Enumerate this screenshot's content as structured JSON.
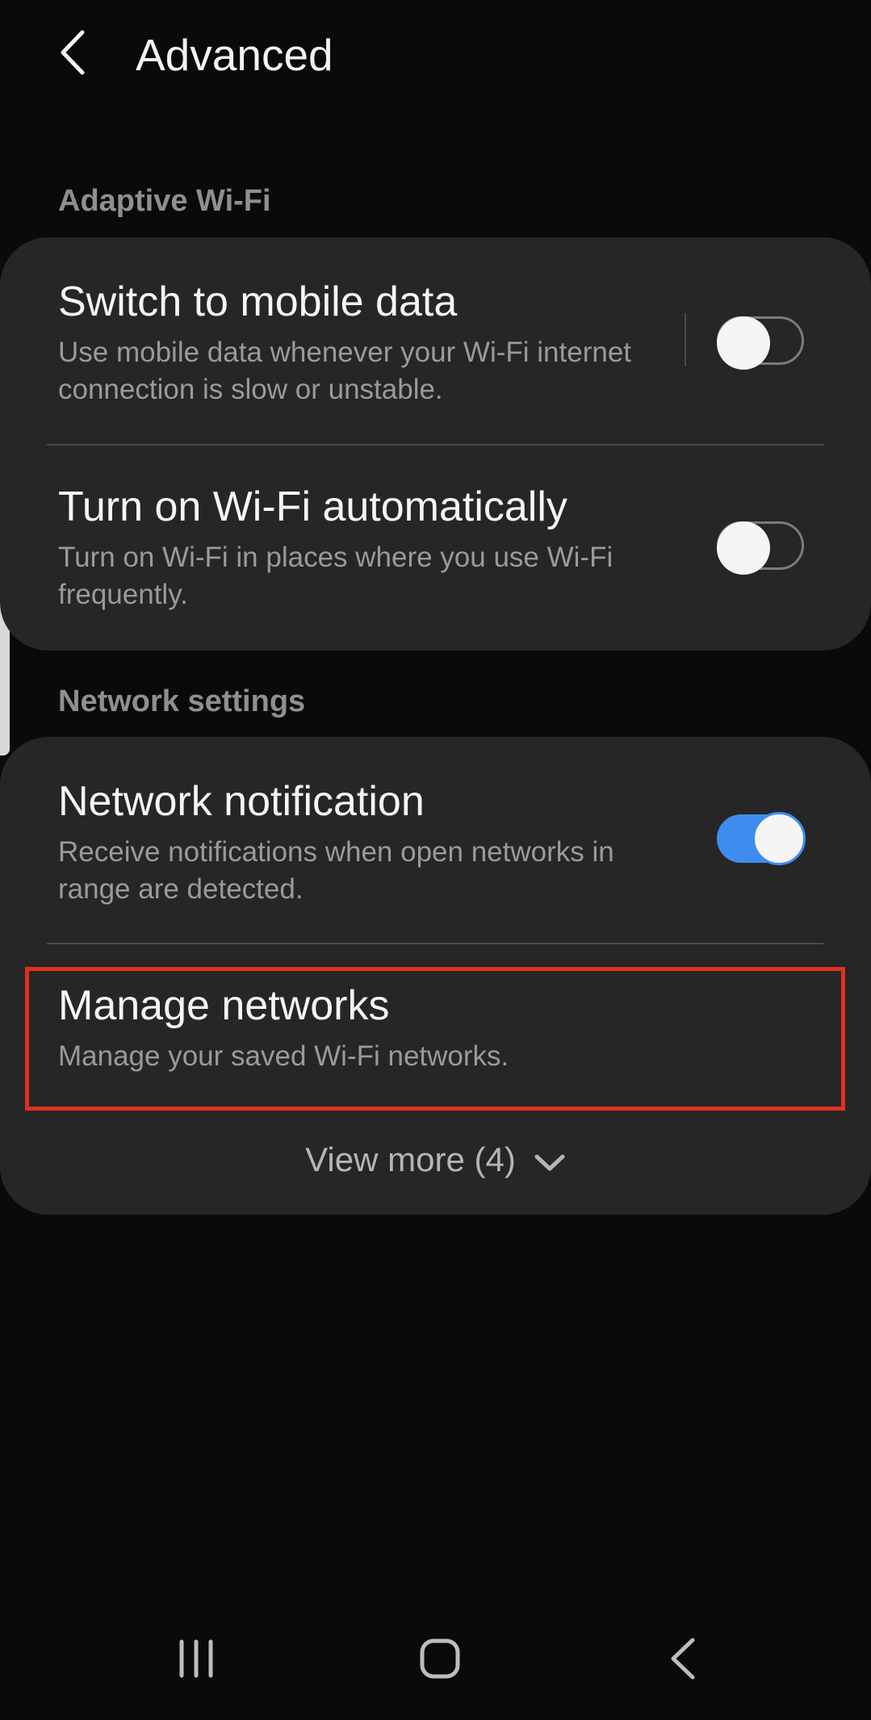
{
  "header": {
    "back_icon": "back-arrow-icon",
    "title": "Advanced"
  },
  "sections": [
    {
      "label": "Adaptive Wi-Fi",
      "items": [
        {
          "title": "Switch to mobile data",
          "subtitle": "Use mobile data whenever your Wi-Fi internet connection is slow or unstable.",
          "toggle": false
        },
        {
          "title": "Turn on Wi-Fi automatically",
          "subtitle": "Turn on Wi-Fi in places where you use Wi-Fi frequently.",
          "toggle": false
        }
      ]
    },
    {
      "label": "Network settings",
      "items": [
        {
          "title": "Network notification",
          "subtitle": "Receive notifications when open networks in range are detected.",
          "toggle": true
        },
        {
          "title": "Manage networks",
          "subtitle": "Manage your saved Wi-Fi networks."
        }
      ],
      "view_more": "View more (4)"
    }
  ],
  "navbar": {
    "recent_icon": "recent-apps-icon",
    "home_icon": "home-icon",
    "back_icon": "back-icon"
  },
  "colors": {
    "background": "#0a0a0a",
    "card": "#262626",
    "accent": "#3e8cf0",
    "highlight": "#e0301e"
  }
}
